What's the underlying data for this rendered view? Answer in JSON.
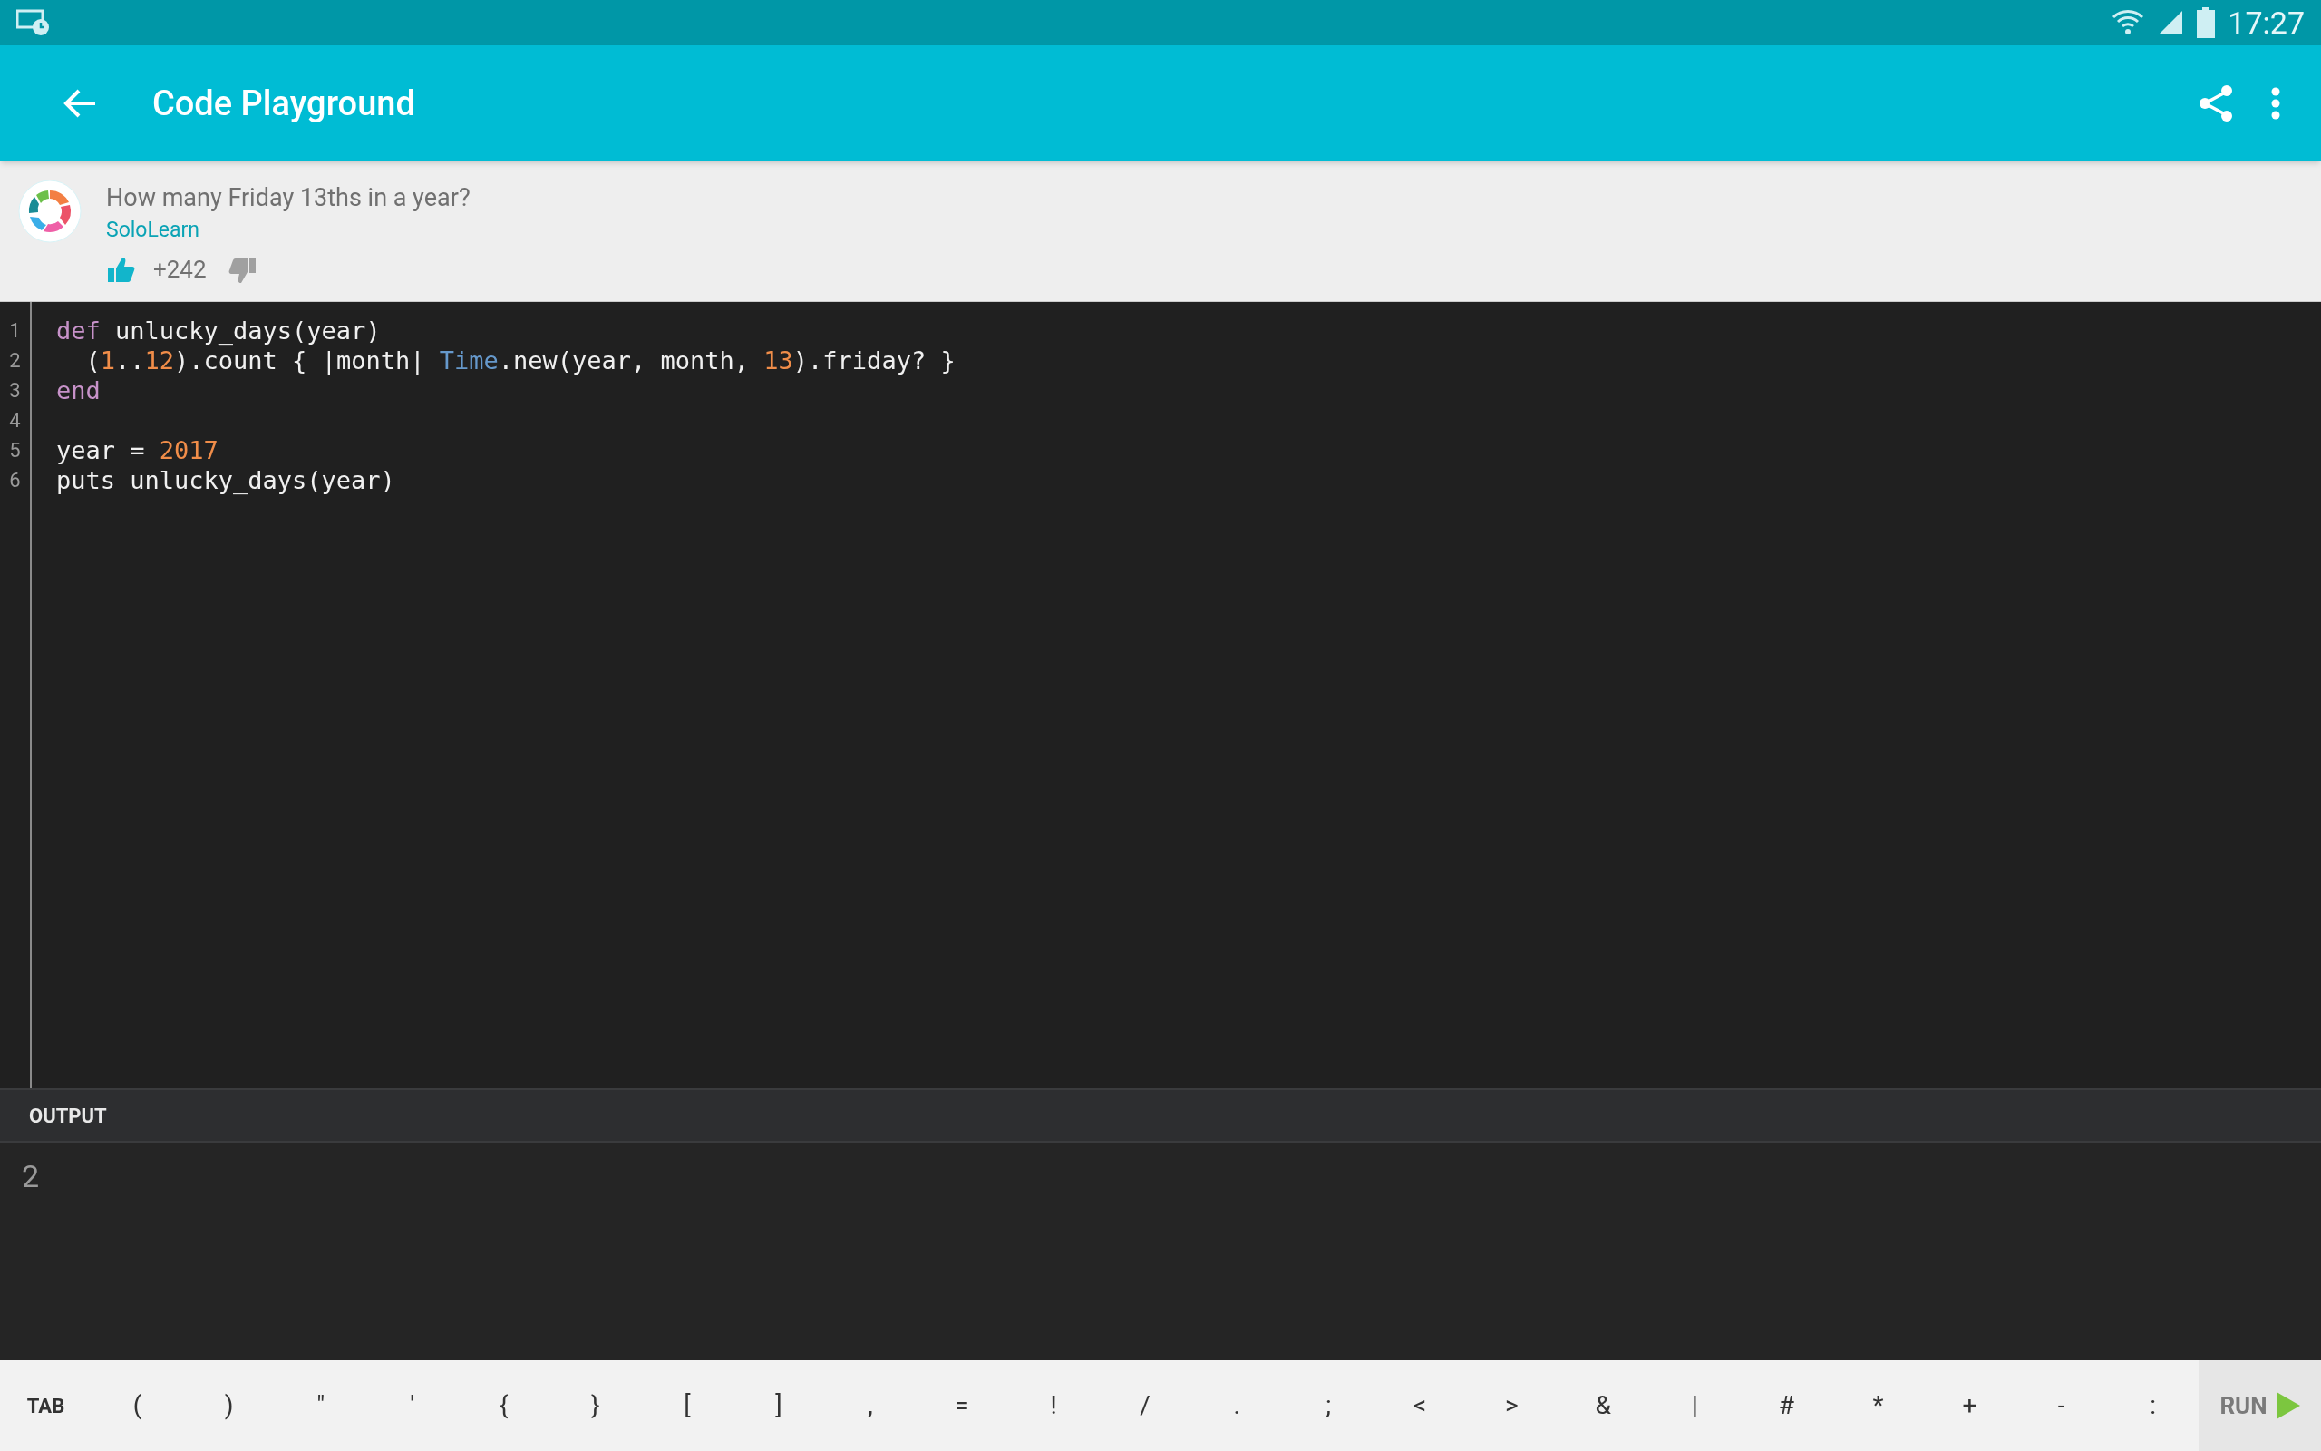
{
  "status_bar": {
    "time": "17:27"
  },
  "app_bar": {
    "title": "Code Playground"
  },
  "post": {
    "question": "How many Friday 13ths in a year?",
    "author": "SoloLearn",
    "votes": "+242",
    "upvoted": true
  },
  "editor": {
    "lines": [
      {
        "number": "1",
        "tokens": [
          {
            "text": "def",
            "kind": "keyword"
          },
          {
            "text": " unlucky_days(year)",
            "kind": "plain"
          }
        ]
      },
      {
        "number": "2",
        "tokens": [
          {
            "text": "  (",
            "kind": "plain"
          },
          {
            "text": "1",
            "kind": "number"
          },
          {
            "text": "..",
            "kind": "plain"
          },
          {
            "text": "12",
            "kind": "number"
          },
          {
            "text": ").count { |month| ",
            "kind": "plain"
          },
          {
            "text": "Time",
            "kind": "constant"
          },
          {
            "text": ".new(year, month, ",
            "kind": "plain"
          },
          {
            "text": "13",
            "kind": "number"
          },
          {
            "text": ").friday? }",
            "kind": "plain"
          }
        ]
      },
      {
        "number": "3",
        "tokens": [
          {
            "text": "end",
            "kind": "keyword"
          }
        ]
      },
      {
        "number": "4"
      },
      {
        "number": "5",
        "tokens": [
          {
            "text": "year = ",
            "kind": "plain"
          },
          {
            "text": "2017",
            "kind": "number"
          }
        ]
      },
      {
        "number": "6",
        "tokens": [
          {
            "text": "puts unlucky_days(year)",
            "kind": "plain"
          }
        ]
      }
    ]
  },
  "output": {
    "heading": "OUTPUT",
    "text": "2"
  },
  "keys": [
    "TAB",
    "(",
    ")",
    "\"",
    "'",
    "{",
    "}",
    "[",
    "]",
    ",",
    "=",
    "!",
    "/",
    ".",
    ";",
    "<",
    ">",
    "&",
    "|",
    "#",
    "*",
    "+",
    "-",
    ":"
  ],
  "run_button": {
    "label": "RUN"
  }
}
